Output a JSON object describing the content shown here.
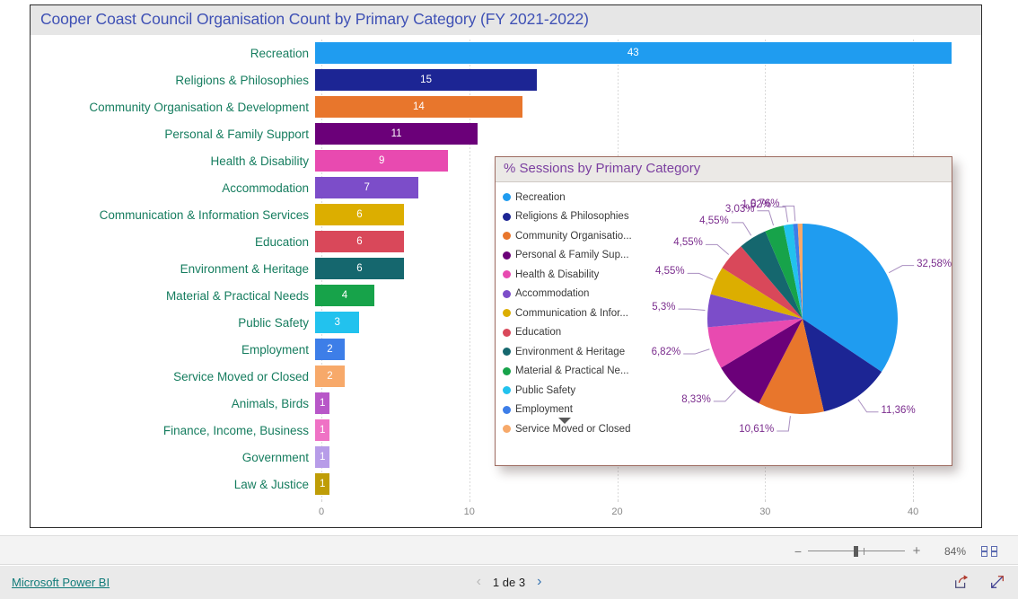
{
  "report": {
    "title": "Cooper Coast Council Organisation Count by Primary Category (FY 2021-2022)"
  },
  "bar_visual": {
    "title": "Cooper Coast Council Organisation Count by Primary Category (FY 2021-2022)"
  },
  "pie_visual": {
    "title": "% Sessions by Primary Category",
    "more_icon": "chevron-down-icon"
  },
  "statusbar": {
    "zoom_minus": "−",
    "zoom_plus": "+",
    "zoom_percent": "84%",
    "fit_icon": "fit-to-page-icon"
  },
  "footer": {
    "brand": "Microsoft Power BI",
    "prev_icon": "‹",
    "next_icon": "›",
    "page_label": "1 de 3",
    "share_icon": "share-icon",
    "fullscreen_icon": "fullscreen-icon"
  },
  "chart_data": [
    {
      "type": "bar",
      "title": "Cooper Coast Council Organisation Count by Primary Category (FY 2021-2022)",
      "orientation": "horizontal",
      "xlabel": "",
      "ylabel": "",
      "xlim": [
        0,
        44
      ],
      "xticks": [
        0,
        10,
        20,
        30,
        40
      ],
      "grid": true,
      "categories": [
        "Recreation",
        "Religions & Philosophies",
        "Community Organisation & Development",
        "Personal & Family Support",
        "Health & Disability",
        "Accommodation",
        "Communication & Information Services",
        "Education",
        "Environment & Heritage",
        "Material & Practical Needs",
        "Public Safety",
        "Employment",
        "Service Moved or Closed",
        "Animals, Birds",
        "Finance, Income, Business",
        "Government",
        "Law & Justice"
      ],
      "values": [
        43,
        15,
        14,
        11,
        9,
        7,
        6,
        6,
        6,
        4,
        3,
        2,
        2,
        1,
        1,
        1,
        1
      ],
      "colors": [
        "#1f9cf0",
        "#1c2594",
        "#e8762c",
        "#6b0079",
        "#e84ab0",
        "#7c4dc9",
        "#dcae00",
        "#d9485a",
        "#15676e",
        "#17a34a",
        "#22c2ee",
        "#3d7ee8",
        "#f7a96a",
        "#b857c8",
        "#ef72c5",
        "#b79ce8",
        "#bf9d07"
      ]
    },
    {
      "type": "pie",
      "title": "% Sessions by Primary Category",
      "legend_position": "left",
      "labels": [
        "Recreation",
        "Religions & Philosophies",
        "Community Organisatio...",
        "Personal & Family Sup...",
        "Health & Disability",
        "Accommodation",
        "Communication & Infor...",
        "Education",
        "Environment & Heritage",
        "Material & Practical Ne...",
        "Public Safety",
        "Employment",
        "Service Moved or Closed"
      ],
      "values": [
        32.58,
        11.36,
        10.61,
        8.33,
        6.82,
        5.3,
        4.55,
        4.55,
        4.55,
        3.03,
        1.52,
        0.76,
        0.76
      ],
      "value_labels": [
        "32,58%",
        "11,36%",
        "10,61%",
        "8,33%",
        "6,82%",
        "5,3%",
        "4,55%",
        "4,55%",
        "4,55%",
        "3,03%",
        "1,52%",
        "0,76%"
      ],
      "colors": [
        "#1f9cf0",
        "#1c2594",
        "#e8762c",
        "#6b0079",
        "#e84ab0",
        "#7c4dc9",
        "#dcae00",
        "#d9485a",
        "#15676e",
        "#17a34a",
        "#22c2ee",
        "#3d7ee8",
        "#f7a96a",
        "#b857c8",
        "#ef72c5",
        "#b79ce8",
        "#bf9d07"
      ]
    }
  ]
}
